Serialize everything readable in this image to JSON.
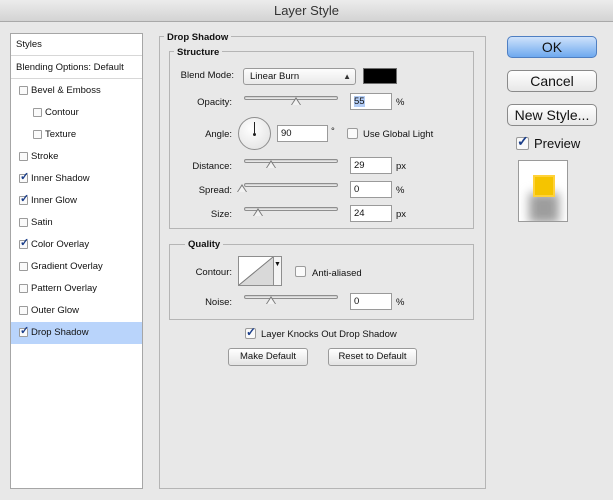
{
  "window": {
    "title": "Layer Style"
  },
  "styles_list": {
    "header": "Styles",
    "blending": "Blending Options: Default",
    "items": [
      {
        "label": "Bevel & Emboss",
        "checked": false,
        "sub": false,
        "selected": false
      },
      {
        "label": "Contour",
        "checked": false,
        "sub": true,
        "selected": false
      },
      {
        "label": "Texture",
        "checked": false,
        "sub": true,
        "selected": false
      },
      {
        "label": "Stroke",
        "checked": false,
        "sub": false,
        "selected": false
      },
      {
        "label": "Inner Shadow",
        "checked": true,
        "sub": false,
        "selected": false
      },
      {
        "label": "Inner Glow",
        "checked": true,
        "sub": false,
        "selected": false
      },
      {
        "label": "Satin",
        "checked": false,
        "sub": false,
        "selected": false
      },
      {
        "label": "Color Overlay",
        "checked": true,
        "sub": false,
        "selected": false
      },
      {
        "label": "Gradient Overlay",
        "checked": false,
        "sub": false,
        "selected": false
      },
      {
        "label": "Pattern Overlay",
        "checked": false,
        "sub": false,
        "selected": false
      },
      {
        "label": "Outer Glow",
        "checked": false,
        "sub": false,
        "selected": false
      },
      {
        "label": "Drop Shadow",
        "checked": true,
        "sub": false,
        "selected": true
      }
    ]
  },
  "panel": {
    "title": "Drop Shadow",
    "structure": {
      "title": "Structure",
      "blend_mode_label": "Blend Mode:",
      "blend_mode_value": "Linear Burn",
      "shadow_color": "#000000",
      "opacity_label": "Opacity:",
      "opacity_value": "55",
      "opacity_unit": "%",
      "angle_label": "Angle:",
      "angle_value": "90",
      "angle_unit": "°",
      "use_global_light_label": "Use Global Light",
      "use_global_light_checked": false,
      "distance_label": "Distance:",
      "distance_value": "29",
      "distance_unit": "px",
      "spread_label": "Spread:",
      "spread_value": "0",
      "spread_unit": "%",
      "size_label": "Size:",
      "size_value": "24",
      "size_unit": "px"
    },
    "quality": {
      "title": "Quality",
      "contour_label": "Contour:",
      "anti_aliased_label": "Anti-aliased",
      "anti_aliased_checked": false,
      "noise_label": "Noise:",
      "noise_value": "0",
      "noise_unit": "%"
    },
    "knockout_label": "Layer Knocks Out Drop Shadow",
    "knockout_checked": true,
    "make_default_label": "Make Default",
    "reset_default_label": "Reset to Default"
  },
  "buttons": {
    "ok": "OK",
    "cancel": "Cancel",
    "new_style": "New Style...",
    "preview_label": "Preview",
    "preview_checked": true
  },
  "colors": {
    "selection": "#b9d4fb",
    "preview_swatch": "#f5c400"
  }
}
